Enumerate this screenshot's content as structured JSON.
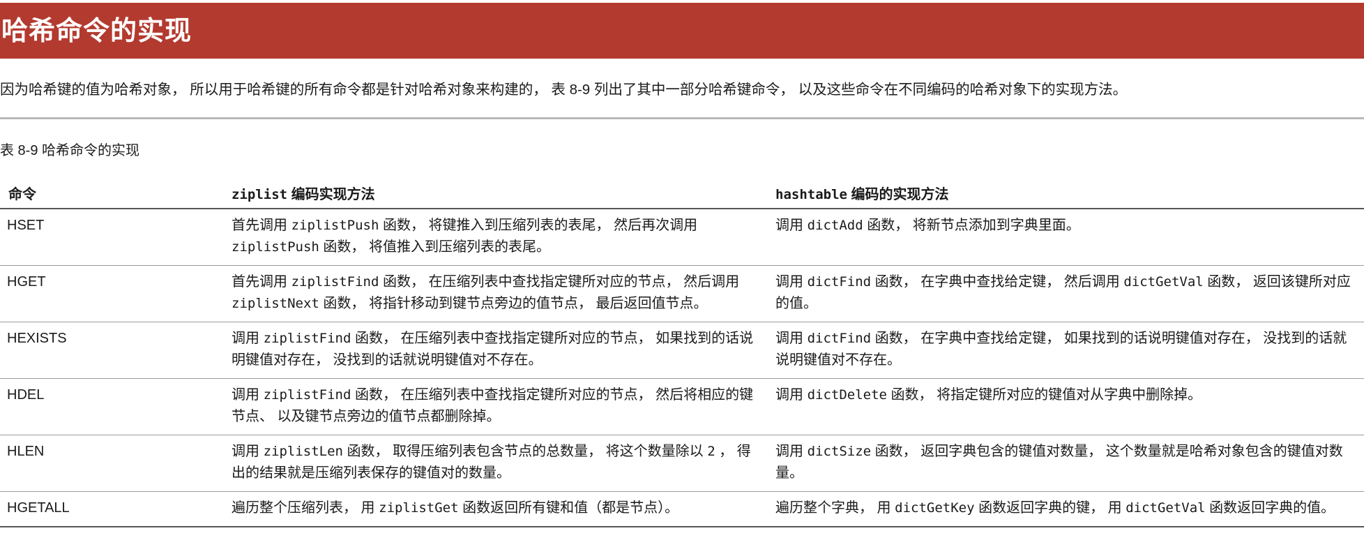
{
  "title": "哈希命令的实现",
  "intro": "因为哈希键的值为哈希对象， 所以用于哈希键的所有命令都是针对哈希对象来构建的， 表 8-9 列出了其中一部分哈希键命令， 以及这些命令在不同编码的哈希对象下的实现方法。",
  "caption": "表 8-9 哈希命令的实现",
  "table": {
    "headers": {
      "command": "命令",
      "ziplist_code": "ziplist",
      "ziplist_suffix": " 编码实现方法",
      "hashtable_code": "hashtable",
      "hashtable_suffix": " 编码的实现方法"
    },
    "rows": [
      {
        "command": "HSET",
        "ziplist": [
          "首先调用 ",
          {
            "code": "ziplistPush"
          },
          " 函数， 将键推入到压缩列表的表尾， 然后再次调用 ",
          {
            "code": "ziplistPush"
          },
          " 函数， 将值推入到压缩列表的表尾。"
        ],
        "hashtable": [
          "调用 ",
          {
            "code": "dictAdd"
          },
          " 函数， 将新节点添加到字典里面。"
        ]
      },
      {
        "command": "HGET",
        "ziplist": [
          "首先调用 ",
          {
            "code": "ziplistFind"
          },
          " 函数， 在压缩列表中查找指定键所对应的节点， 然后调用 ",
          {
            "code": "ziplistNext"
          },
          " 函数， 将指针移动到键节点旁边的值节点， 最后返回值节点。"
        ],
        "hashtable": [
          "调用 ",
          {
            "code": "dictFind"
          },
          " 函数， 在字典中查找给定键， 然后调用 ",
          {
            "code": "dictGetVal"
          },
          " 函数， 返回该键所对应的值。"
        ]
      },
      {
        "command": "HEXISTS",
        "ziplist": [
          "调用 ",
          {
            "code": "ziplistFind"
          },
          " 函数， 在压缩列表中查找指定键所对应的节点， 如果找到的话说明键值对存在， 没找到的话就说明键值对不存在。"
        ],
        "hashtable": [
          "调用 ",
          {
            "code": "dictFind"
          },
          " 函数， 在字典中查找给定键， 如果找到的话说明键值对存在， 没找到的话就说明键值对不存在。"
        ]
      },
      {
        "command": "HDEL",
        "ziplist": [
          "调用 ",
          {
            "code": "ziplistFind"
          },
          " 函数， 在压缩列表中查找指定键所对应的节点， 然后将相应的键节点、 以及键节点旁边的值节点都删除掉。"
        ],
        "hashtable": [
          "调用 ",
          {
            "code": "dictDelete"
          },
          " 函数， 将指定键所对应的键值对从字典中删除掉。"
        ]
      },
      {
        "command": "HLEN",
        "ziplist": [
          "调用 ",
          {
            "code": "ziplistLen"
          },
          " 函数， 取得压缩列表包含节点的总数量， 将这个数量除以 ",
          {
            "code": "2"
          },
          " ， 得出的结果就是压缩列表保存的键值对的数量。"
        ],
        "hashtable": [
          "调用 ",
          {
            "code": "dictSize"
          },
          " 函数， 返回字典包含的键值对数量， 这个数量就是哈希对象包含的键值对数量。"
        ]
      },
      {
        "command": "HGETALL",
        "ziplist": [
          "遍历整个压缩列表， 用 ",
          {
            "code": "ziplistGet"
          },
          " 函数返回所有键和值（都是节点）。"
        ],
        "hashtable": [
          "遍历整个字典， 用 ",
          {
            "code": "dictGetKey"
          },
          " 函数返回字典的键， 用 ",
          {
            "code": "dictGetVal"
          },
          " 函数返回字典的值。"
        ]
      }
    ]
  },
  "colors": {
    "title_bar": "#b33a2f",
    "title_text": "#ffffff",
    "divider": "#b9b9b9"
  }
}
